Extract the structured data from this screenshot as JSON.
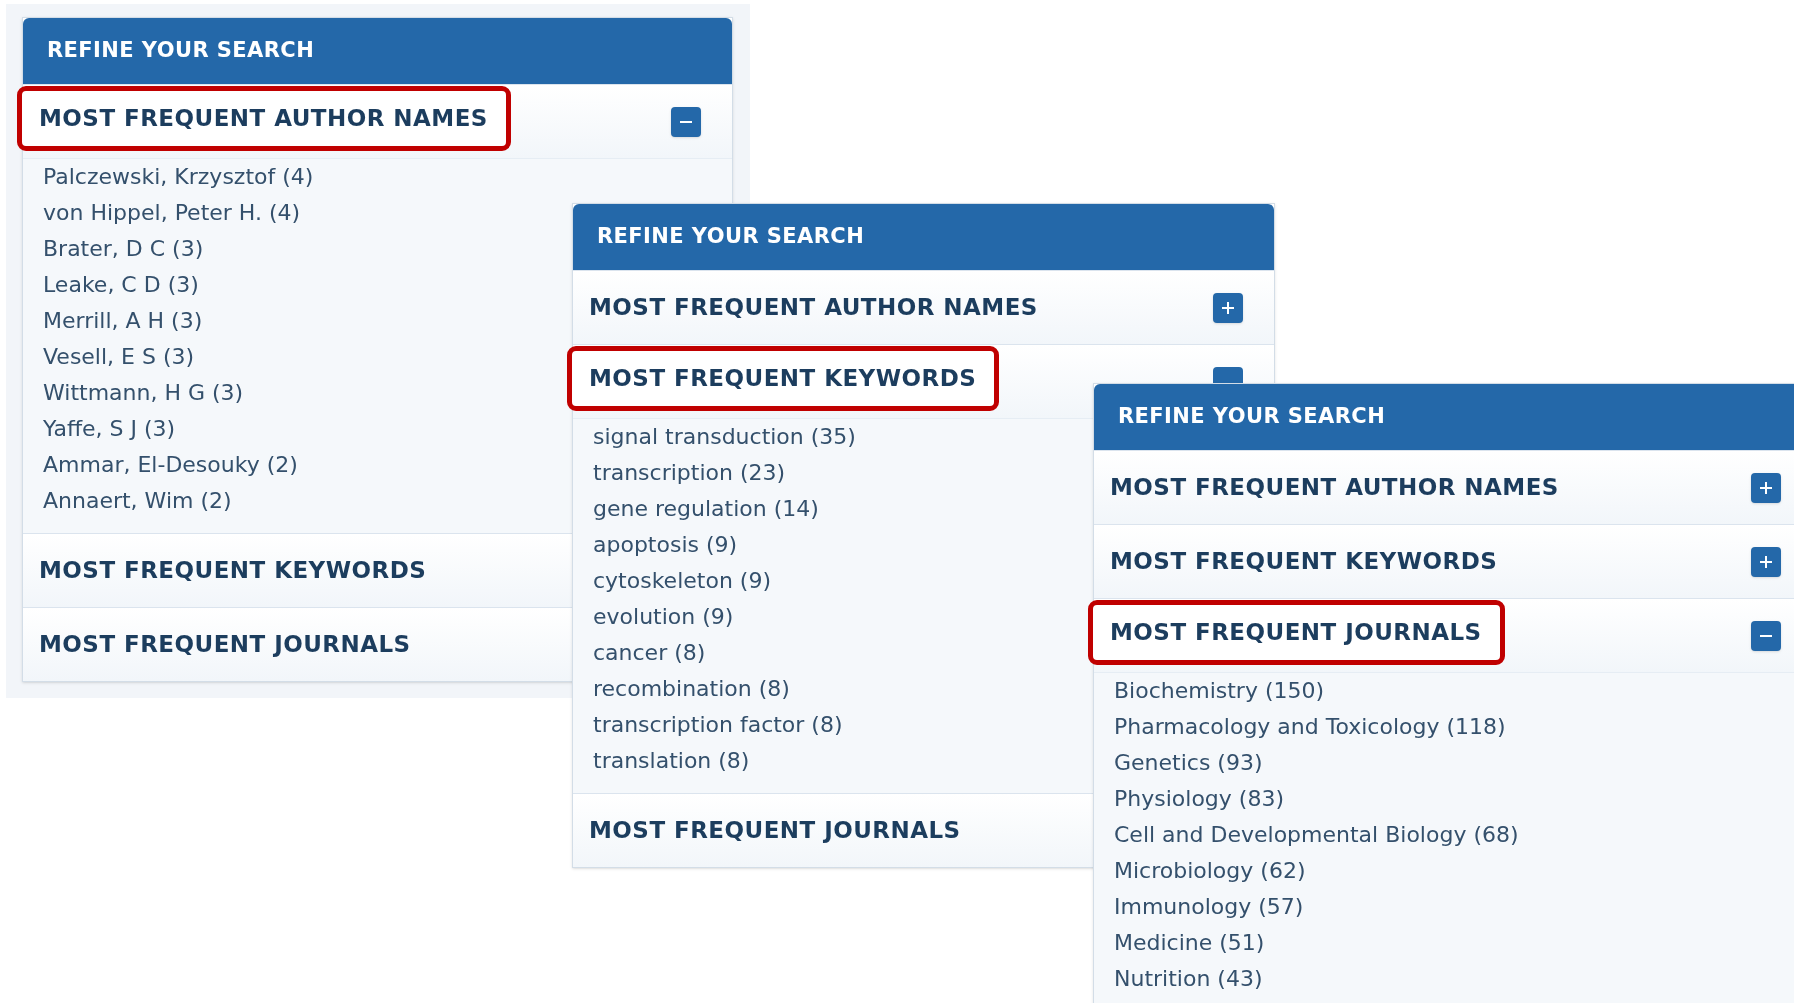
{
  "panels": [
    {
      "title": "REFINE YOUR SEARCH",
      "sections": [
        {
          "title": "MOST FREQUENT AUTHOR NAMES",
          "highlighted": true,
          "expanded": true,
          "items": [
            "Palczewski, Krzysztof (4)",
            "von Hippel, Peter H. (4)",
            "Brater, D C (3)",
            "Leake, C D (3)",
            "Merrill, A H (3)",
            "Vesell, E S (3)",
            "Wittmann, H G (3)",
            "Yaffe, S J (3)",
            "Ammar, El-Desouky (2)",
            "Annaert, Wim (2)"
          ]
        },
        {
          "title": "MOST FREQUENT KEYWORDS",
          "highlighted": false
        },
        {
          "title": "MOST FREQUENT JOURNALS",
          "highlighted": false
        }
      ]
    },
    {
      "title": "REFINE YOUR SEARCH",
      "sections": [
        {
          "title": "MOST FREQUENT AUTHOR NAMES",
          "highlighted": false,
          "expanded": false
        },
        {
          "title": "MOST FREQUENT KEYWORDS",
          "highlighted": true,
          "expanded": true,
          "items": [
            "signal transduction (35)",
            "transcription (23)",
            "gene regulation (14)",
            "apoptosis (9)",
            "cytoskeleton (9)",
            "evolution (9)",
            "cancer (8)",
            "recombination (8)",
            "transcription factor (8)",
            "translation (8)"
          ]
        },
        {
          "title": "MOST FREQUENT JOURNALS",
          "highlighted": false
        }
      ]
    },
    {
      "title": "REFINE YOUR SEARCH",
      "sections": [
        {
          "title": "MOST FREQUENT AUTHOR NAMES",
          "highlighted": false,
          "expanded": false
        },
        {
          "title": "MOST FREQUENT KEYWORDS",
          "highlighted": false,
          "expanded": false
        },
        {
          "title": "MOST FREQUENT JOURNALS",
          "highlighted": true,
          "expanded": true,
          "items": [
            "Biochemistry (150)",
            "Pharmacology and Toxicology (118)",
            "Genetics (93)",
            "Physiology (83)",
            "Cell and Developmental Biology (68)",
            "Microbiology (62)",
            "Immunology (57)",
            "Medicine (51)",
            "Nutrition (43)"
          ]
        }
      ]
    }
  ]
}
